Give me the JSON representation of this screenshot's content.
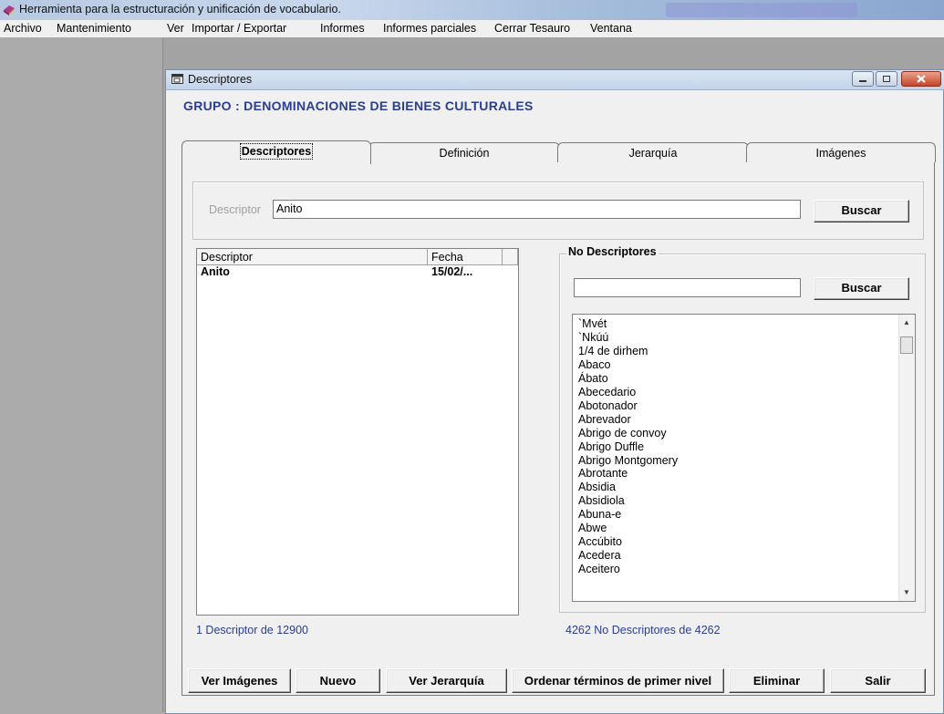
{
  "app": {
    "title": "Herramienta para la estructuración y unificación de vocabulario."
  },
  "menu": [
    "Archivo",
    "Mantenimiento",
    "Ver",
    "Importar / Exportar",
    "Informes",
    "Informes parciales",
    "Cerrar Tesauro",
    "Ventana"
  ],
  "child_window": {
    "title": "Descriptores",
    "group_title": "GRUPO : DENOMINACIONES DE BIENES CULTURALES"
  },
  "tabs": [
    "Descriptores",
    "Definición",
    "Jerarquía",
    "Imágenes"
  ],
  "search": {
    "label": "Descriptor",
    "value": "Anito",
    "button": "Buscar"
  },
  "descriptor_list": {
    "columns": [
      "Descriptor",
      "Fecha"
    ],
    "rows": [
      {
        "descriptor": "Anito",
        "fecha": "15/02/..."
      }
    ],
    "count_text": "1  Descriptor  de 12900"
  },
  "no_descriptores": {
    "legend": "No Descriptores",
    "search_value": "",
    "button": "Buscar",
    "items": [
      "`Mvét",
      "`Nkúú",
      "1/4 de dirhem",
      "Abaco",
      "Ábato",
      "Abecedario",
      "Abotonador",
      "Abrevador",
      "Abrigo de convoy",
      "Abrigo Duffle",
      "Abrigo Montgomery",
      "Abrotante",
      "Absidia",
      "Absidiola",
      "Abuna-e",
      "Abwe",
      "Accúbito",
      "Acedera",
      "Aceitero"
    ],
    "count_text": "4262  No Descriptores  de 4262"
  },
  "bottom_buttons": [
    "Ver Imágenes",
    "Nuevo",
    "Ver Jerarquía",
    "Ordenar términos de primer nivel",
    "Eliminar",
    "Salir"
  ],
  "colors": {
    "accent_text": "#2b3e8f",
    "titlebar": "#c4d4e8",
    "background": "#ababab"
  }
}
